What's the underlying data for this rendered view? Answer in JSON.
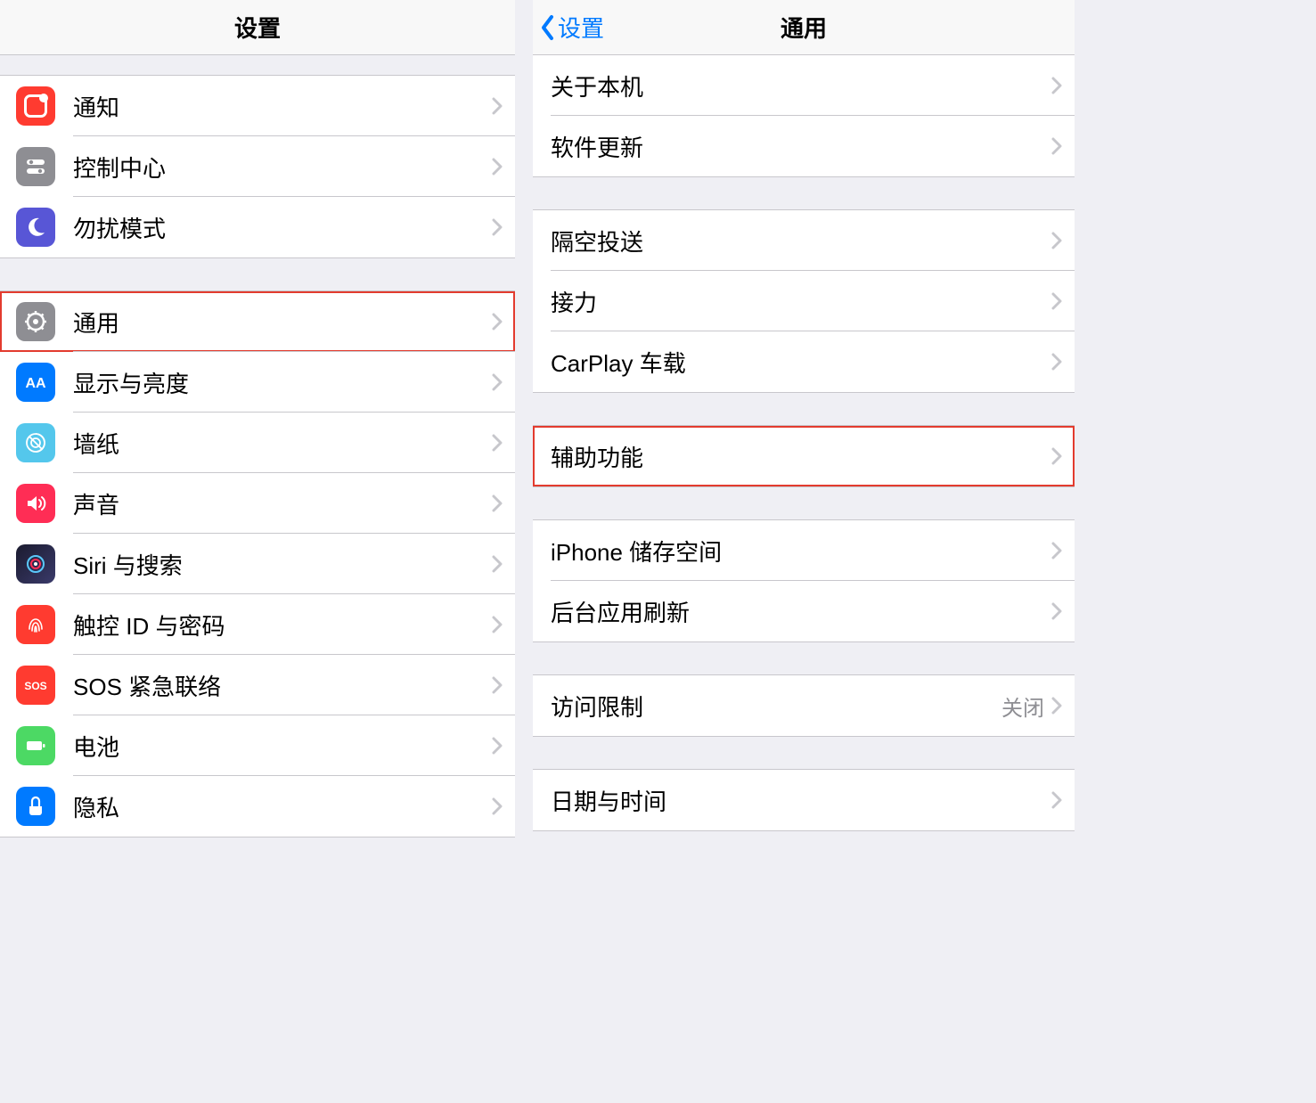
{
  "left": {
    "title": "设置",
    "groups": [
      {
        "rows": [
          {
            "icon": "notif",
            "name": "row-notifications",
            "icon_name": "notifications-icon",
            "label": "通知"
          },
          {
            "icon": "cc",
            "name": "row-control-center",
            "icon_name": "control-center-icon",
            "label": "控制中心"
          },
          {
            "icon": "dnd",
            "name": "row-do-not-disturb",
            "icon_name": "moon-icon",
            "label": "勿扰模式"
          }
        ]
      },
      {
        "rows": [
          {
            "icon": "gen",
            "name": "row-general",
            "icon_name": "gear-icon",
            "label": "通用",
            "highlight": true
          },
          {
            "icon": "disp",
            "name": "row-display-brightness",
            "icon_name": "display-icon",
            "label": "显示与亮度"
          },
          {
            "icon": "wall",
            "name": "row-wallpaper",
            "icon_name": "wallpaper-icon",
            "label": "墙纸"
          },
          {
            "icon": "sound",
            "name": "row-sounds",
            "icon_name": "speaker-icon",
            "label": "声音"
          },
          {
            "icon": "siri",
            "name": "row-siri-search",
            "icon_name": "siri-icon",
            "label": "Siri 与搜索"
          },
          {
            "icon": "touch",
            "name": "row-touch-id",
            "icon_name": "fingerprint-icon",
            "label": "触控 ID 与密码"
          },
          {
            "icon": "sos",
            "name": "row-emergency-sos",
            "icon_name": "sos-icon",
            "label": "SOS 紧急联络"
          },
          {
            "icon": "batt",
            "name": "row-battery",
            "icon_name": "battery-icon",
            "label": "电池"
          },
          {
            "icon": "priv",
            "name": "row-privacy",
            "icon_name": "hand-icon",
            "label": "隐私"
          }
        ]
      }
    ]
  },
  "right": {
    "back_label": "设置",
    "title": "通用",
    "groups": [
      {
        "partial_top": true,
        "rows": [
          {
            "name": "row-about",
            "label": "关于本机"
          },
          {
            "name": "row-software-update",
            "label": "软件更新"
          }
        ]
      },
      {
        "rows": [
          {
            "name": "row-airdrop",
            "label": "隔空投送"
          },
          {
            "name": "row-handoff",
            "label": "接力"
          },
          {
            "name": "row-carplay",
            "label": "CarPlay 车载"
          }
        ]
      },
      {
        "rows": [
          {
            "name": "row-accessibility",
            "label": "辅助功能",
            "highlight": true
          }
        ]
      },
      {
        "rows": [
          {
            "name": "row-iphone-storage",
            "label": "iPhone 储存空间"
          },
          {
            "name": "row-background-refresh",
            "label": "后台应用刷新"
          }
        ]
      },
      {
        "rows": [
          {
            "name": "row-restrictions",
            "label": "访问限制",
            "detail": "关闭"
          }
        ]
      },
      {
        "rows": [
          {
            "name": "row-date-time",
            "label": "日期与时间"
          }
        ]
      }
    ]
  }
}
